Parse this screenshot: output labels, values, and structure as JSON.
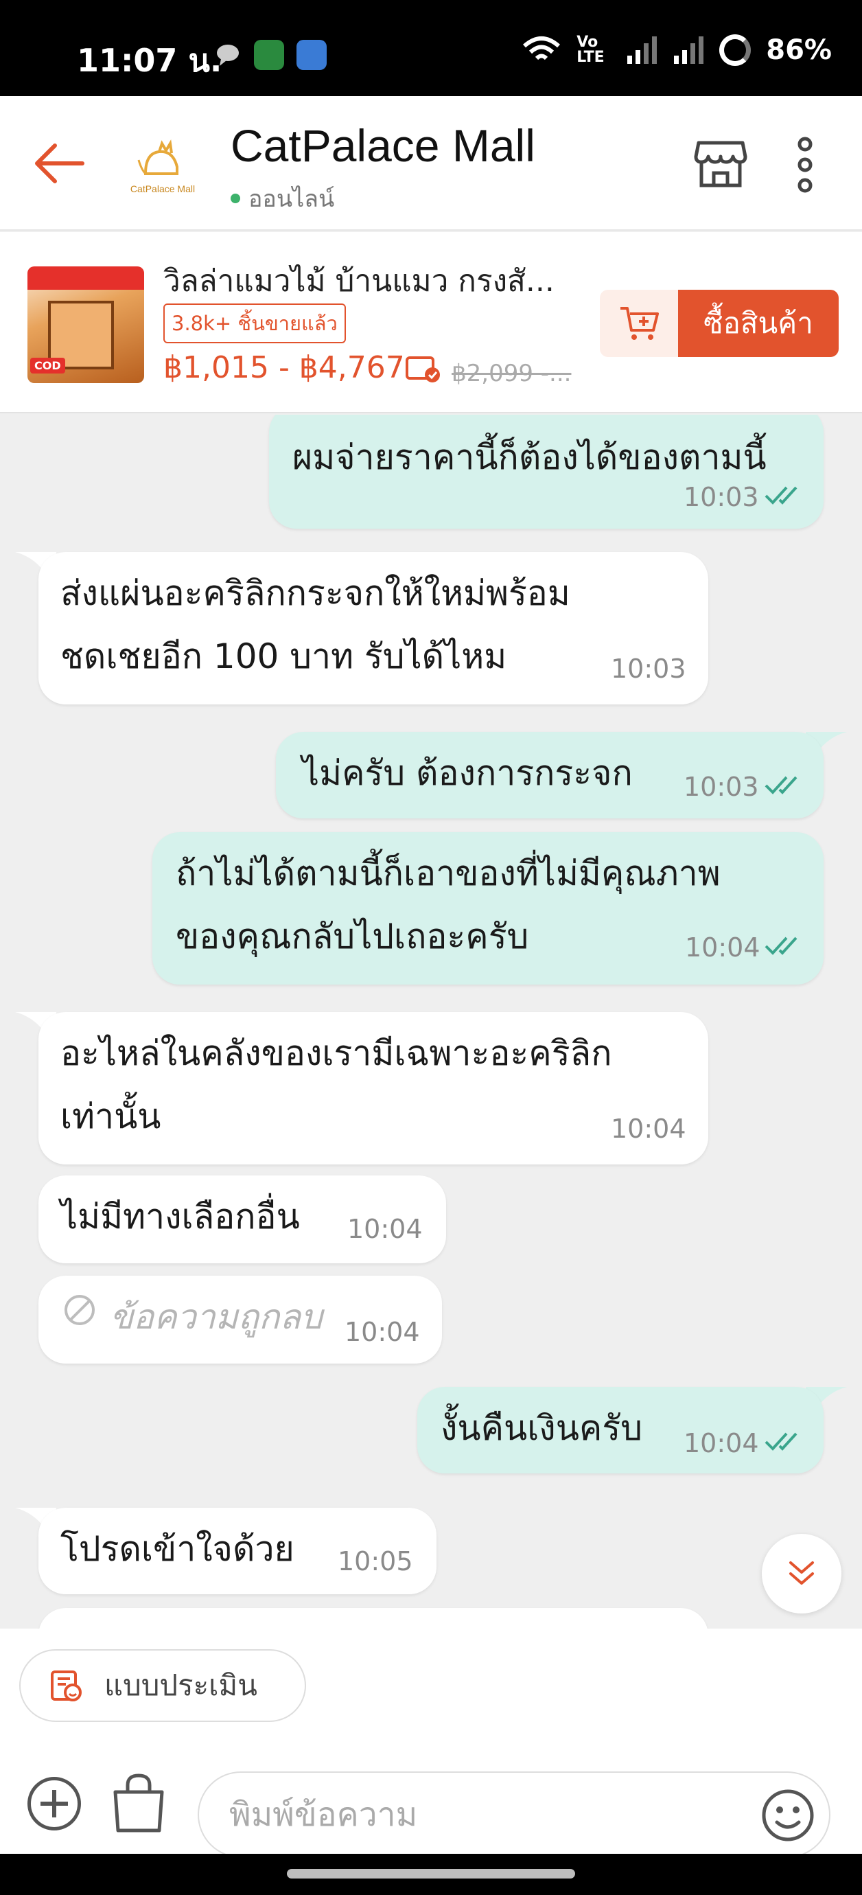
{
  "status": {
    "time": "11:07 น.",
    "battery": "86%",
    "net_label": "Vo LTE"
  },
  "header": {
    "shop_name": "CatPalace Mall",
    "online_status": "ออนไลน์",
    "logo_text": "CatPalace Mall"
  },
  "product": {
    "title": "วิลล่าแมวไม้ บ้านแมว กรงสั...",
    "sold": "3.8k+ ชิ้นขายแล้ว",
    "price": "฿1,015 - ฿4,767",
    "old_price": "฿2,099 -...",
    "buy_label": "ซื้อสินค้า",
    "cod_label": "COD"
  },
  "messages": [
    {
      "dir": "out",
      "lines": [
        "ผมจ่ายราคานี้ก็ต้องได้ของตามนี้"
      ],
      "time": "10:03"
    },
    {
      "dir": "in",
      "lines": [
        "ส่งแผ่นอะคริลิกกระจกให้ใหม่พร้อม",
        "ชดเชยอีก 100 บาท รับได้ไหม"
      ],
      "time": "10:03"
    },
    {
      "dir": "out",
      "lines": [
        "ไม่ครับ ต้องการกระจก"
      ],
      "time": "10:03"
    },
    {
      "dir": "out",
      "lines": [
        "ถ้าไม่ได้ตามนี้ก็เอาของที่ไม่มีคุณภาพ",
        "ของคุณกลับไปเถอะครับ"
      ],
      "time": "10:04"
    },
    {
      "dir": "in",
      "lines": [
        "อะไหล่ในคลังของเรามีเฉพาะอะคริลิก",
        "เท่านั้น"
      ],
      "time": "10:04"
    },
    {
      "dir": "in",
      "lines": [
        "ไม่มีทางเลือกอื่น"
      ],
      "time": "10:04"
    },
    {
      "dir": "in",
      "lines": [
        "ข้อความถูกลบ"
      ],
      "time": "10:04",
      "deleted": true
    },
    {
      "dir": "out",
      "lines": [
        "งั้นคืนเงินครับ"
      ],
      "time": "10:04"
    },
    {
      "dir": "in",
      "lines": [
        "โปรดเข้าใจด้วย"
      ],
      "time": "10:05"
    }
  ],
  "composer": {
    "eval_label": "แบบประเมิน",
    "placeholder": "พิมพ์ข้อความ"
  },
  "colors": {
    "accent": "#e2532d",
    "outgoing_bubble": "#d6f2ec",
    "incoming_bubble": "#ffffff",
    "read_tick": "#3aa58c",
    "online_dot": "#3db26b"
  },
  "icons": [
    "back-arrow-icon",
    "store-icon",
    "more-vertical-icon",
    "add-to-cart-icon",
    "voucher-icon",
    "double-check-icon",
    "deleted-icon",
    "chevron-down-double-icon",
    "evaluation-icon",
    "add-icon",
    "bag-icon",
    "emoji-icon"
  ]
}
